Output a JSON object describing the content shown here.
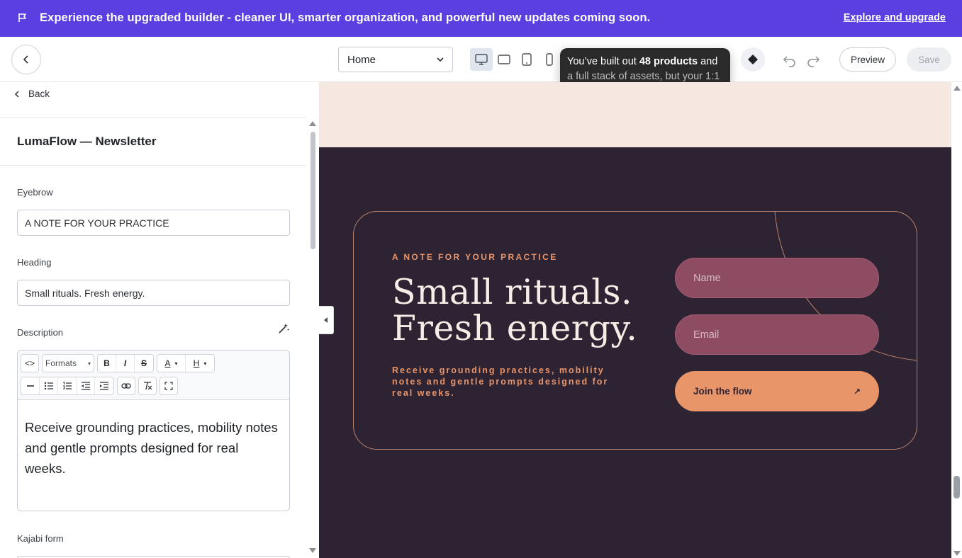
{
  "banner": {
    "message": "Experience the upgraded builder - cleaner UI, smarter organization, and powerful new updates coming soon.",
    "cta": "Explore and upgrade",
    "color": "#5b3fe0"
  },
  "toolbar": {
    "page_select_value": "Home",
    "devices": [
      "desktop",
      "tablet-landscape",
      "tablet-portrait",
      "mobile"
    ],
    "tooltip": {
      "prefix": "You’ve built out ",
      "highlight": "48 products",
      "suffix": " and",
      "line2": "a full stack of assets, but your 1:1"
    },
    "preview_label": "Preview",
    "save_label": "Save"
  },
  "sidebar": {
    "back_label": "Back",
    "section_title": "LumaFlow — Newsletter",
    "fields": {
      "eyebrow_label": "Eyebrow",
      "eyebrow_value": "A NOTE FOR YOUR PRACTICE",
      "heading_label": "Heading",
      "heading_value": "Small rituals. Fresh energy.",
      "description_label": "Description",
      "description_value": "Receive grounding practices, mobility notes and gentle prompts designed for real weeks.",
      "kajabi_form_label": "Kajabi form"
    },
    "editor_toolbar": {
      "code": "<>",
      "formats": "Formats",
      "bold": "B",
      "italic": "I",
      "strike": "S",
      "text_color": "A",
      "highlight": "H"
    }
  },
  "canvas": {
    "eyebrow": "A NOTE FOR YOUR PRACTICE",
    "heading_line1": "Small rituals.",
    "heading_line2": "Fresh energy.",
    "description": "Receive grounding practices, mobility notes and gentle prompts designed for real weeks.",
    "name_placeholder": "Name",
    "email_placeholder": "Email",
    "button_label": "Join the flow",
    "button_icon": "↗",
    "colors": {
      "background": "#2e2333",
      "accent": "#e8956a",
      "field": "#8e4c63",
      "top_band": "#f4e8e1"
    }
  }
}
